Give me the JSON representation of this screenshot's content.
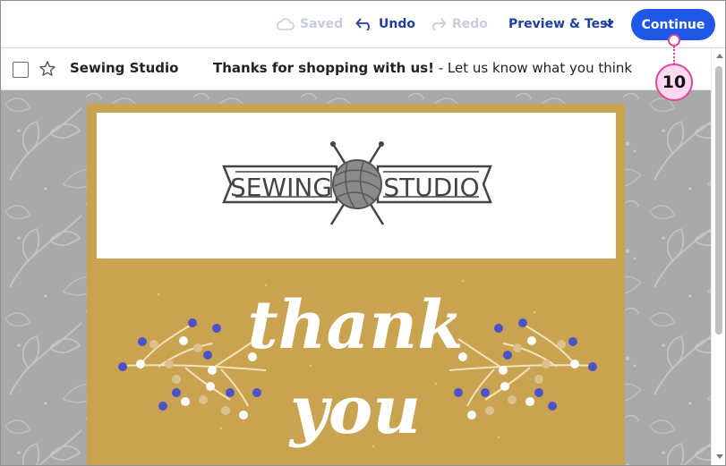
{
  "toolbar": {
    "saved_label": "Saved",
    "undo_label": "Undo",
    "redo_label": "Redo",
    "preview_label": "Preview & Test",
    "continue_label": "Continue",
    "icons": {
      "saved": "cloud-icon",
      "undo": "undo-arrow-icon",
      "redo": "redo-arrow-icon",
      "preview_menu": "chevron-down-icon"
    }
  },
  "inbox_preview": {
    "sender": "Sewing Studio",
    "subject": "Thanks for shopping with us!",
    "snippet": " - Let us know what you think",
    "icons": {
      "select": "checkbox-icon",
      "favorite": "star-icon"
    }
  },
  "email": {
    "logo": {
      "left_word": "SEWING",
      "right_word": "STUDIO"
    },
    "hero": {
      "line1": "thank",
      "line2": "you"
    }
  },
  "callout": {
    "number": "10"
  },
  "colors": {
    "accent": "#1f57e6",
    "link": "#1f3f9f",
    "disabled": "#c6cedd",
    "email_background": "#c9a34f",
    "pattern_background": "#a9a9a9",
    "callout": "#e0479d"
  }
}
